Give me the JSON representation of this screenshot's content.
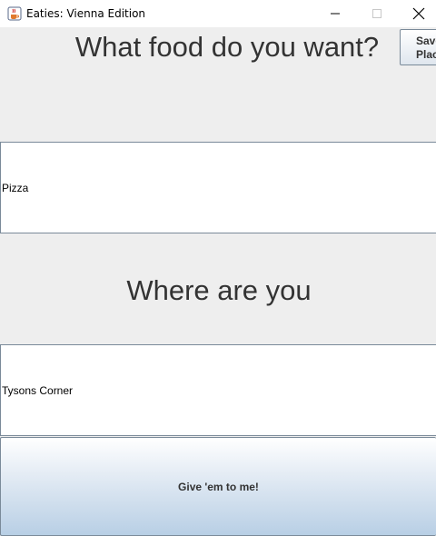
{
  "window": {
    "title": "Eaties: Vienna Edition",
    "icon": "java-cup-icon",
    "controls": [
      "minimize",
      "maximize",
      "close"
    ]
  },
  "main": {
    "food_heading": "What food do you want?",
    "save_button_label": "Save\nPlac",
    "food_value": "Pizza",
    "where_heading": "Where are you",
    "where_value": "Tysons Corner",
    "submit_label": "Give 'em to me!"
  }
}
